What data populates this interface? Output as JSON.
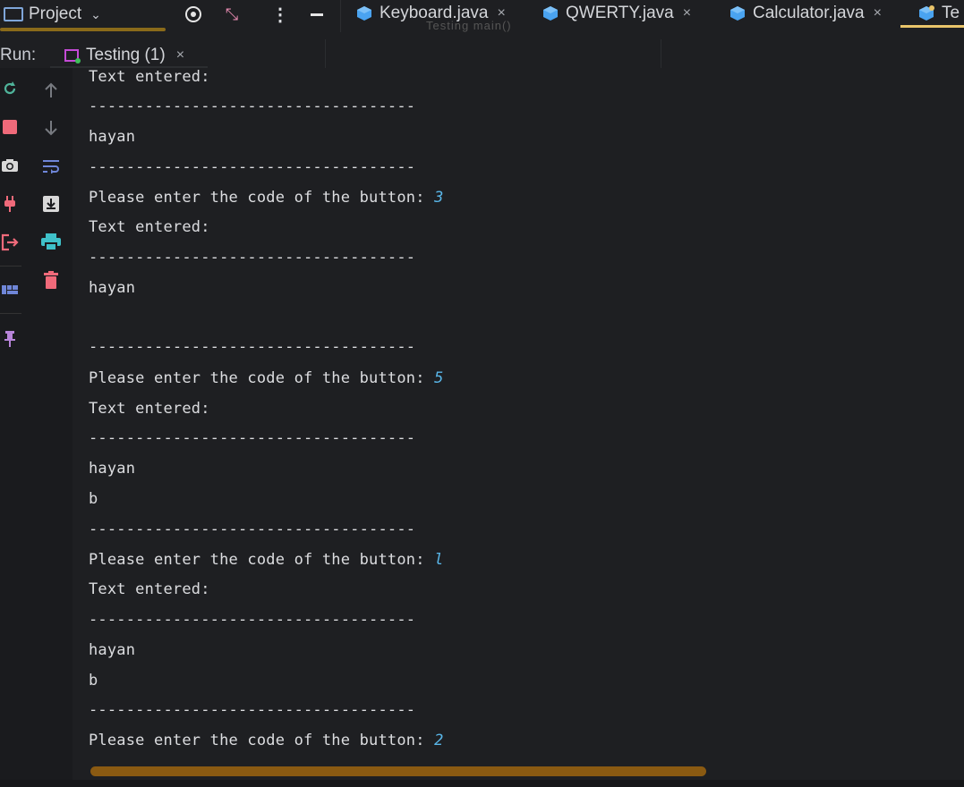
{
  "topbar": {
    "project_label": "Project",
    "tabs": [
      {
        "label": "Keyboard.java",
        "close": "×"
      },
      {
        "label": "QWERTY.java",
        "close": "×"
      },
      {
        "label": "Calculator.java",
        "close": "×"
      },
      {
        "label": "Te"
      }
    ],
    "breadcrumb": "Testing   main()"
  },
  "run": {
    "label": "Run:",
    "tab_label": "Testing (1)",
    "tab_close": "×"
  },
  "console": {
    "lines": [
      {
        "text": "Text entered:"
      },
      {
        "text": "-----------------------------------"
      },
      {
        "text": "hayan"
      },
      {
        "text": "-----------------------------------"
      },
      {
        "text": "Please enter the code of the button: ",
        "input": "3"
      },
      {
        "text": "Text entered:"
      },
      {
        "text": "-----------------------------------"
      },
      {
        "text": "hayan"
      },
      {
        "text": "-----------------------------------"
      },
      {
        "text": "Please enter the code of the button: ",
        "input": "5"
      },
      {
        "text": "Text entered:"
      },
      {
        "text": "-----------------------------------"
      },
      {
        "text": "hayan"
      },
      {
        "text": "b"
      },
      {
        "text": "-----------------------------------"
      },
      {
        "text": "Please enter the code of the button: ",
        "input": "l"
      },
      {
        "text": "Text entered:"
      },
      {
        "text": "-----------------------------------"
      },
      {
        "text": "hayan"
      },
      {
        "text": "b"
      },
      {
        "text": "-----------------------------------"
      },
      {
        "text": "Please enter the code of the button: ",
        "input": "2"
      }
    ]
  },
  "colors": {
    "background": "#1e1f22",
    "input_text": "#59b6e8",
    "active_tab_underline": "#e9c46a",
    "scrollbar": "#8a5a12"
  }
}
